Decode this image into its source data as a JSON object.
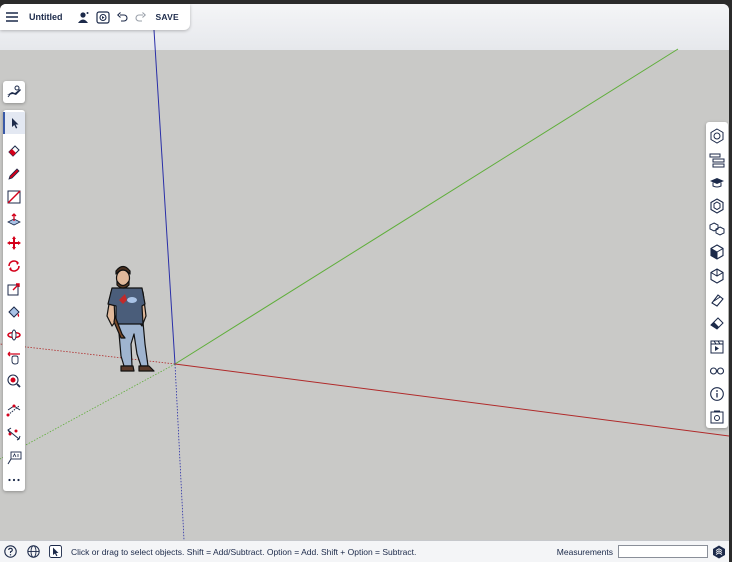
{
  "app": {
    "document_title": "Untitled",
    "save_label": "SAVE"
  },
  "left_toolbar": {
    "top_tool": "search-warehouse-icon",
    "tools": [
      "select-icon",
      "eraser-icon",
      "pencil-icon",
      "line-icon",
      "push-pull-icon",
      "move-icon",
      "rotate-icon",
      "scale-icon",
      "paint-bucket-icon",
      "orbit-icon",
      "pan-icon",
      "zoom-icon",
      "tape-measure-icon",
      "dimension-icon",
      "text-label-icon",
      "more-icon"
    ]
  },
  "right_panel": {
    "tools": [
      "entity-info-icon",
      "outliner-icon",
      "instructor-icon",
      "components-icon",
      "materials-icon",
      "styles-icon",
      "layers-icon",
      "soften-icon",
      "eraser-panel-icon",
      "scenes-icon",
      "display-icon",
      "info-icon",
      "screenshot-icon"
    ]
  },
  "status_bar": {
    "hint": "Click or drag to select objects. Shift = Add/Subtract. Option = Add. Shift + Option = Subtract.",
    "measurements_label": "Measurements",
    "measurements_value": ""
  },
  "colors": {
    "red_axis": "#b02a2a",
    "green_axis": "#5fae3a",
    "blue_axis": "#2a2fa8",
    "ground": "#c9c9c7",
    "accent_red": "#d4001a"
  }
}
